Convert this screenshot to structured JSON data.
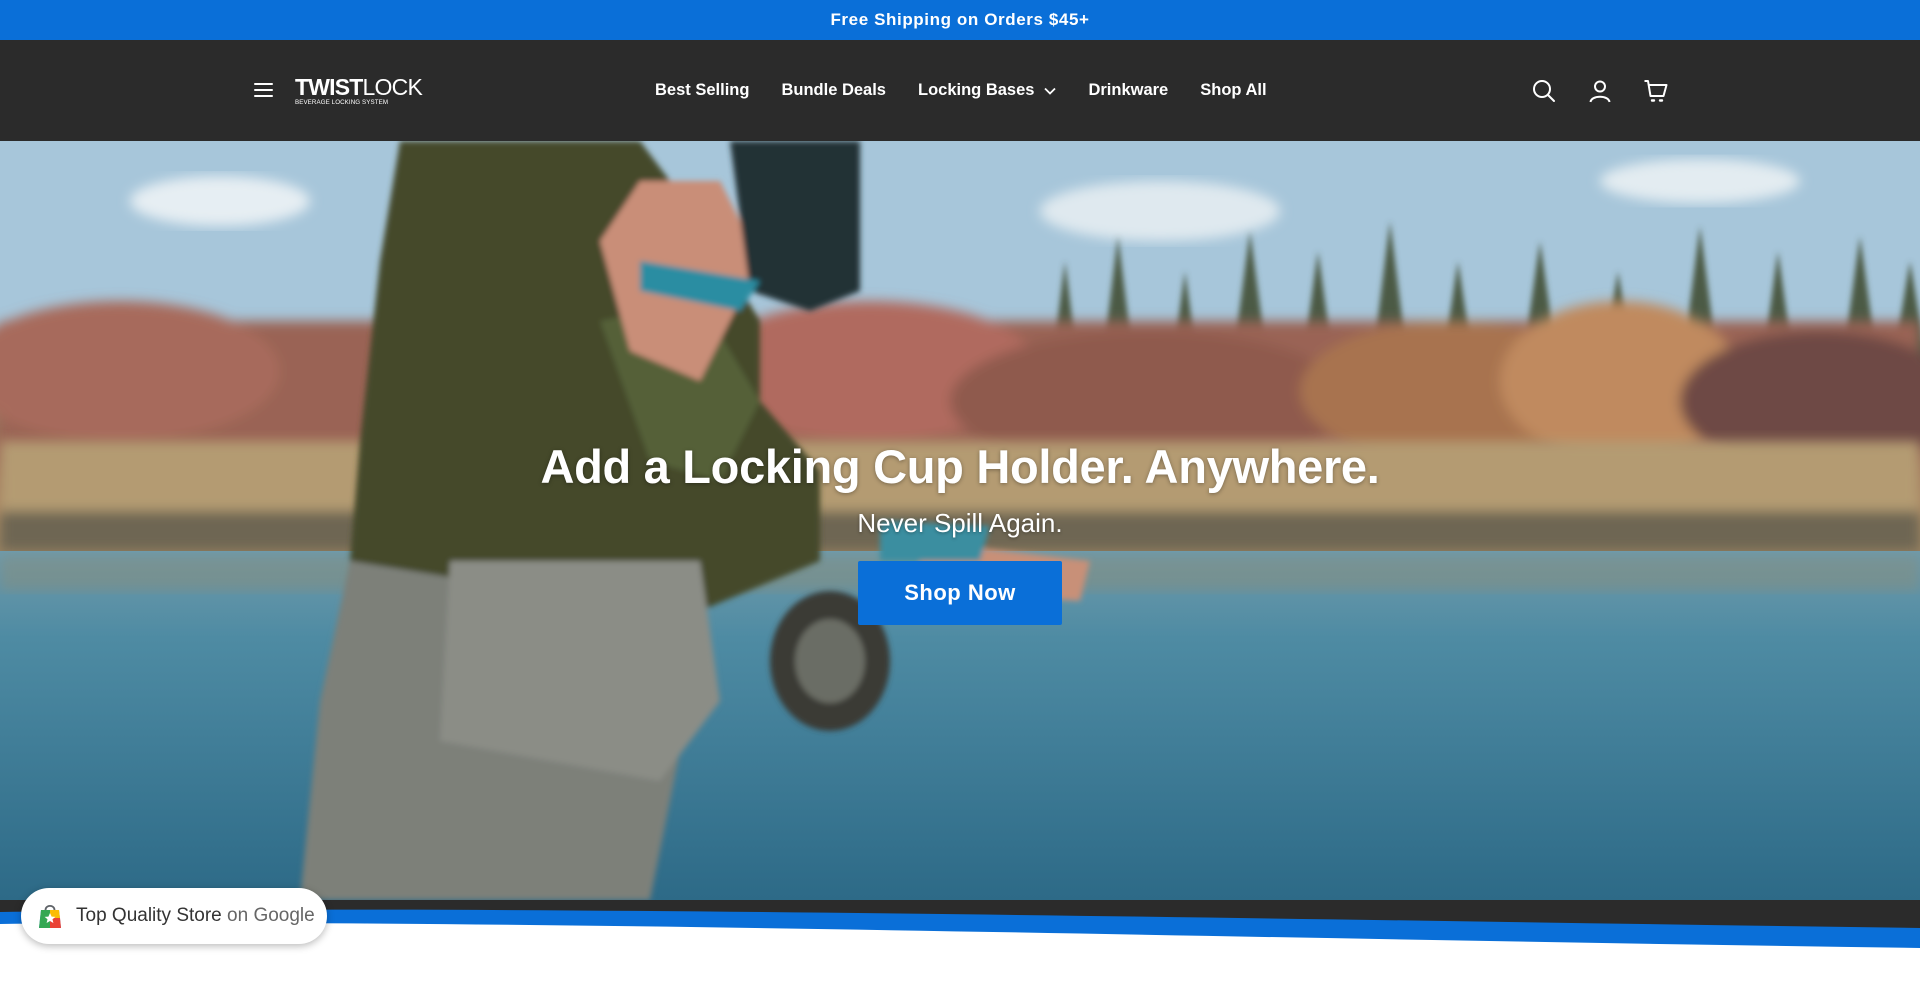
{
  "announcement": {
    "text": "Free Shipping on Orders $45+"
  },
  "header": {
    "logo": {
      "bold": "TWIST",
      "light": "LOCK",
      "tagline": "BEVERAGE LOCKING SYSTEM"
    },
    "nav": [
      {
        "label": "Best Selling"
      },
      {
        "label": "Bundle Deals"
      },
      {
        "label": "Locking Bases",
        "has_dropdown": true
      },
      {
        "label": "Drinkware"
      },
      {
        "label": "Shop All"
      }
    ],
    "icons": [
      "menu-icon",
      "search-icon",
      "account-icon",
      "cart-icon"
    ]
  },
  "hero": {
    "title": "Add a Locking Cup Holder. Anywhere.",
    "subtitle": "Never Spill Again.",
    "cta": "Shop Now"
  },
  "badge": {
    "text": "Top Quality Store",
    "suffix": "on Google"
  },
  "colors": {
    "brand_blue": "#0a6fd8",
    "header_bg": "#2b2b2b",
    "text_light": "#ffffff"
  }
}
